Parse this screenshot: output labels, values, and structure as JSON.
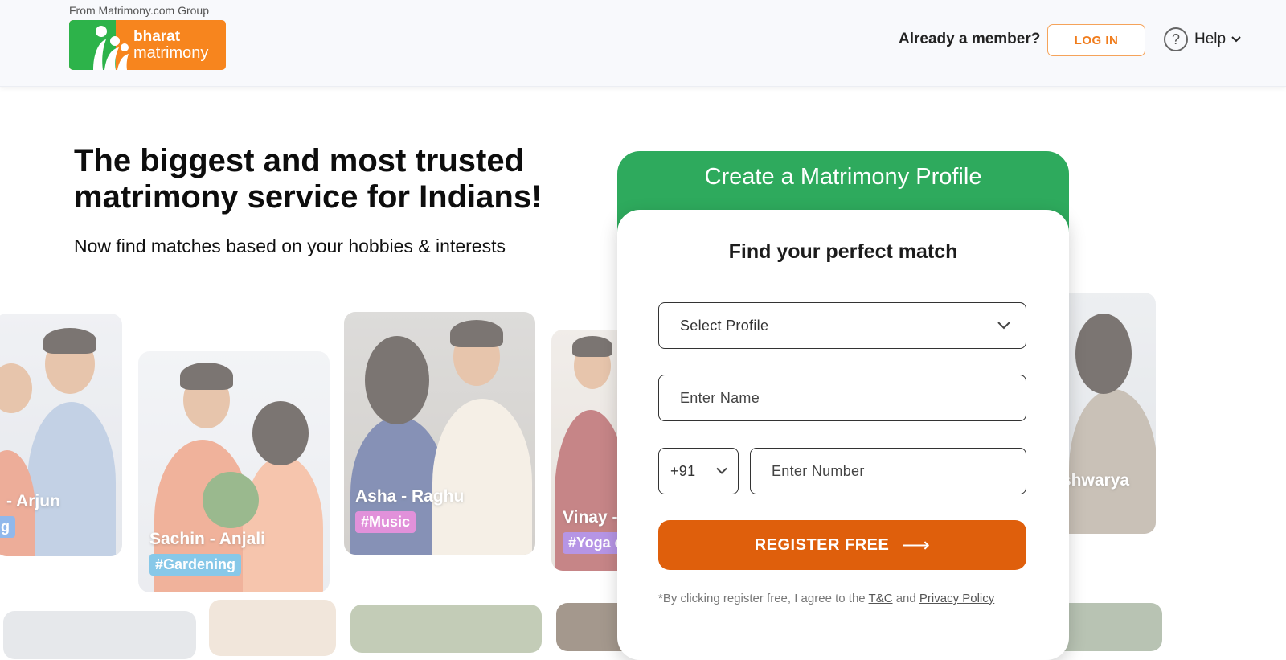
{
  "header": {
    "group_text": "From Matrimony.com Group",
    "logo_line1": "bharat",
    "logo_line2": "matrimony",
    "member_question": "Already a member?",
    "login_label": "LOG IN",
    "help_label": "Help",
    "help_icon_glyph": "?"
  },
  "hero": {
    "headline": "The biggest and most trusted matrimony service for Indians!",
    "subline": "Now find matches based on your hobbies & interests"
  },
  "cards": [
    {
      "couple": "- Arjun",
      "tag": "g",
      "tag_color": "#4f8de0"
    },
    {
      "couple": "Sachin - Anjali",
      "tag": "#Gardening",
      "tag_color": "#3fa7da"
    },
    {
      "couple": "Asha - Raghu",
      "tag": "#Music",
      "tag_color": "#d04fc4"
    },
    {
      "couple": "Vinay -",
      "tag": "#Yoga e",
      "tag_color": "#8a55d6"
    },
    {
      "couple": "Aishwarya",
      "tag": "",
      "tag_color": ""
    }
  ],
  "form": {
    "title": "Create a Matrimony Profile",
    "subtitle": "Find your perfect match",
    "select_profile": "Select Profile",
    "name_placeholder": "Enter Name",
    "country_code": "+91",
    "number_placeholder": "Enter Number",
    "register_label": "REGISTER FREE",
    "register_arrow": "⟶",
    "terms_prefix": "*By clicking register free, I agree to the ",
    "terms_link": "T&C",
    "terms_and": " and ",
    "privacy_link": "Privacy Policy"
  },
  "colors": {
    "brand_orange": "#f7851e",
    "brand_green": "#2db34a",
    "form_header_green": "#2eaa5d",
    "register_orange": "#df5f0c"
  }
}
